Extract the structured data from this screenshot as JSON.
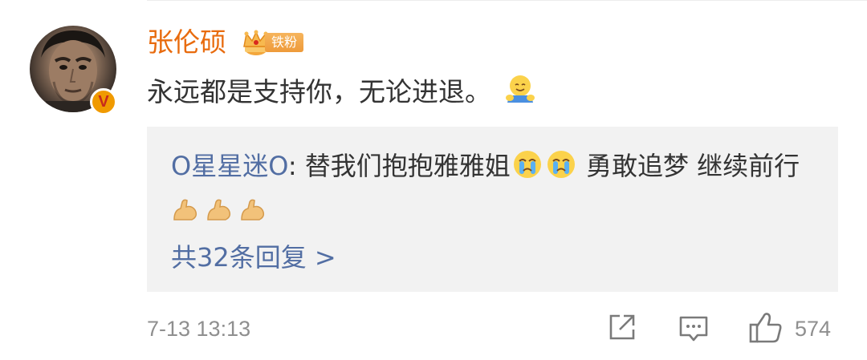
{
  "comment": {
    "username": "张伦硕",
    "fan_badge": "铁粉",
    "text": "永远都是支持你，无论进退。",
    "verified_badge": "V",
    "emoji": "smiling-hug-emoji"
  },
  "reply": {
    "username": "O星星迷O",
    "separator": ": ",
    "text_part1": "替我们抱抱雅雅姐",
    "text_part2": " 勇敢追梦 继续前行",
    "emoji_crying": "crying-emoji",
    "emoji_muscle": "flexed-biceps-emoji",
    "more_replies": "共32条回复 >"
  },
  "footer": {
    "timestamp": "7-13 13:13",
    "like_count": "574"
  },
  "colors": {
    "username": "#e86b0e",
    "link": "#526ea3",
    "muted": "#8f8f8f",
    "reply_bg": "#f2f2f2"
  }
}
